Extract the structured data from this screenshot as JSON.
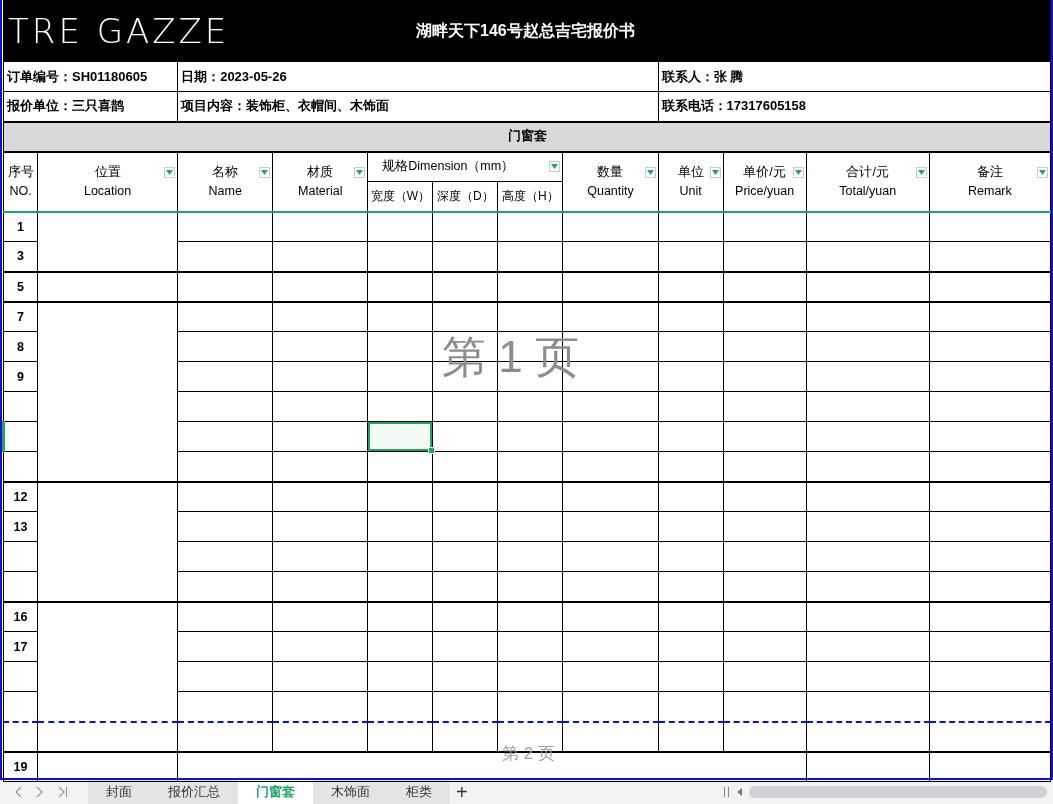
{
  "logo": "TRE GAZZE",
  "title": "湖畔天下146号赵总吉宅报价书",
  "info_rows": [
    [
      "订单编号：SH01180605",
      "日期：2023-05-26",
      "联系人：张 腾"
    ],
    [
      "报价单位：三只喜鹊",
      "项目内容：装饰柜、衣帽间、木饰面",
      "联系电话：17317605158"
    ]
  ],
  "section": "门窗套",
  "columns": [
    {
      "zh": "序号",
      "en": "NO.",
      "filter": false
    },
    {
      "zh": "位置",
      "en": "Location",
      "filter": true
    },
    {
      "zh": "名称",
      "en": "Name",
      "filter": true
    },
    {
      "zh": "材质",
      "en": "Material",
      "filter": true
    }
  ],
  "dimension": {
    "label": "规格Dimension（mm）",
    "filter": true,
    "subs": [
      "宽度（W）",
      "深度（D）",
      "高度（H）"
    ]
  },
  "columns_after": [
    {
      "zh": "数量",
      "en": "Quantity",
      "filter": true
    },
    {
      "zh": "单位",
      "en": "Unit",
      "filter": true
    },
    {
      "zh": "单价/元",
      "en": "Price/yuan",
      "filter": true
    },
    {
      "zh": "合计/元",
      "en": "Total/yuan",
      "filter": true
    },
    {
      "zh": "备注",
      "en": "Remark",
      "filter": true
    }
  ],
  "row_groups": [
    {
      "rows": [
        {
          "no": "1",
          "selected": false,
          "page_break": false
        },
        {
          "no": "3",
          "selected": false,
          "page_break": false
        }
      ]
    },
    {
      "rows": [
        {
          "no": "5",
          "selected": false,
          "page_break": false
        }
      ]
    },
    {
      "rows": [
        {
          "no": "7",
          "selected": false,
          "page_break": false
        },
        {
          "no": "8",
          "selected": false,
          "page_break": false
        },
        {
          "no": "9",
          "selected": false,
          "page_break": false
        },
        {
          "selected": false,
          "page_break": false
        },
        {
          "selected": true,
          "page_break": false
        },
        {
          "selected": false,
          "page_break": false
        }
      ]
    },
    {
      "rows": [
        {
          "no": "12",
          "selected": false,
          "page_break": false
        },
        {
          "no": "13",
          "selected": false,
          "page_break": false
        },
        {
          "selected": false,
          "page_break": false
        },
        {
          "selected": false,
          "page_break": false
        }
      ]
    },
    {
      "rows": [
        {
          "no": "16",
          "selected": false,
          "page_break": false
        },
        {
          "no": "17",
          "selected": false,
          "page_break": false
        },
        {
          "selected": false,
          "page_break": false
        },
        {
          "selected": false,
          "page_break": false
        }
      ]
    },
    {
      "rows": [
        {
          "selected": false,
          "page_break": true
        }
      ]
    }
  ],
  "summary_row": {
    "no": "19"
  },
  "page_labels": [
    "第 1 页",
    "第 2 页"
  ],
  "sheet_tabs": [
    {
      "label": "封面",
      "selected": false
    },
    {
      "label": "报价汇总",
      "selected": false
    },
    {
      "label": "门窗套",
      "selected": true
    },
    {
      "label": "木饰面",
      "selected": false
    },
    {
      "label": "柜类",
      "selected": false
    }
  ],
  "add_sheet": "+"
}
